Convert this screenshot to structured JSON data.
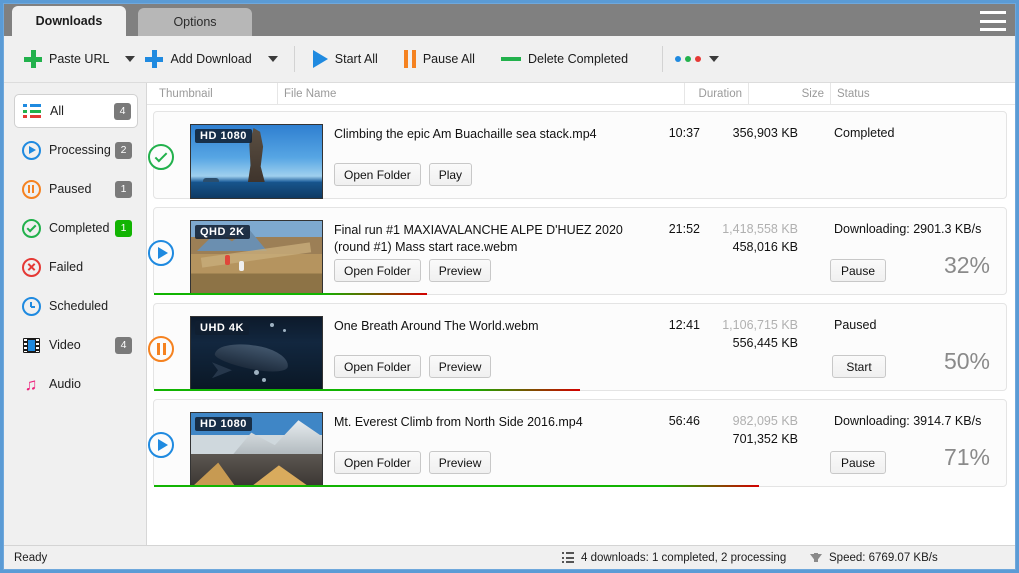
{
  "window": {
    "title": ""
  },
  "tabs": [
    {
      "label": "Downloads",
      "active": true
    },
    {
      "label": "Options",
      "active": false
    }
  ],
  "menu_icon": "hamburger-menu-icon",
  "toolbar": {
    "paste_url": "Paste URL",
    "add_download": "Add Download",
    "start_all": "Start All",
    "pause_all": "Pause All",
    "delete_completed": "Delete Completed",
    "overflow": "more-options",
    "colors": {
      "green": "#22b14c",
      "blue": "#1f8ae0",
      "orange": "#f58220"
    }
  },
  "sidebar": {
    "items": [
      {
        "label": "All",
        "badge": "4",
        "icon": "list-icon",
        "selected": true,
        "badge_color": "#7a7a7a"
      },
      {
        "label": "Processing",
        "badge": "2",
        "icon": "play-circle-icon",
        "selected": false,
        "badge_color": "#7a7a7a"
      },
      {
        "label": "Paused",
        "badge": "1",
        "icon": "pause-circle-icon",
        "selected": false,
        "badge_color": "#7a7a7a"
      },
      {
        "label": "Completed",
        "badge": "1",
        "icon": "check-circle-icon",
        "selected": false,
        "badge_color": "#12b402"
      },
      {
        "label": "Failed",
        "badge": "",
        "icon": "error-circle-icon",
        "selected": false,
        "badge_color": ""
      },
      {
        "label": "Scheduled",
        "badge": "",
        "icon": "clock-icon",
        "selected": false,
        "badge_color": ""
      },
      {
        "label": "Video",
        "badge": "4",
        "icon": "film-icon",
        "selected": false,
        "badge_color": "#7a7a7a"
      },
      {
        "label": "Audio",
        "badge": "",
        "icon": "music-note-icon",
        "selected": false,
        "badge_color": ""
      }
    ]
  },
  "columns": {
    "thumbnail": "Thumbnail",
    "file_name": "File Name",
    "duration": "Duration",
    "size": "Size",
    "status": "Status"
  },
  "downloads": [
    {
      "state": "completed",
      "state_icon": "check-circle-icon",
      "quality_tag": "HD 1080",
      "file_name": "Climbing the epic Am Buachaille sea stack.mp4",
      "duration": "10:37",
      "size_total": "356,903 KB",
      "size_done": "",
      "status": "Completed",
      "percent": "",
      "progress": 100,
      "buttons": [
        "Open Folder",
        "Play"
      ],
      "action_button": ""
    },
    {
      "state": "downloading",
      "state_icon": "play-circle-icon",
      "quality_tag": "QHD 2K",
      "file_name": "Final run #1  MAXIAVALANCHE ALPE D'HUEZ 2020 (round #1) Mass start race.webm",
      "duration": "21:52",
      "size_total": "1,418,558 KB",
      "size_done": "458,016 KB",
      "status": "Downloading: 2901.3 KB/s",
      "percent": "32%",
      "progress": 32,
      "buttons": [
        "Open Folder",
        "Preview"
      ],
      "action_button": "Pause"
    },
    {
      "state": "paused",
      "state_icon": "pause-circle-icon",
      "quality_tag": "UHD 4K",
      "file_name": "One Breath Around The World.webm",
      "duration": "12:41",
      "size_total": "1,106,715 KB",
      "size_done": "556,445 KB",
      "status": "Paused",
      "percent": "50%",
      "progress": 50,
      "buttons": [
        "Open Folder",
        "Preview"
      ],
      "action_button": "Start"
    },
    {
      "state": "downloading",
      "state_icon": "play-circle-icon",
      "quality_tag": "HD 1080",
      "file_name": "Mt. Everest Climb from North Side 2016.mp4",
      "duration": "56:46",
      "size_total": "982,095 KB",
      "size_done": "701,352 KB",
      "status": "Downloading: 3914.7 KB/s",
      "percent": "71%",
      "progress": 71,
      "buttons": [
        "Open Folder",
        "Preview"
      ],
      "action_button": "Pause"
    }
  ],
  "statusbar": {
    "ready": "Ready",
    "counts": "4 downloads: 1 completed, 2 processing",
    "speed": "Speed: 6769.07 KB/s"
  }
}
